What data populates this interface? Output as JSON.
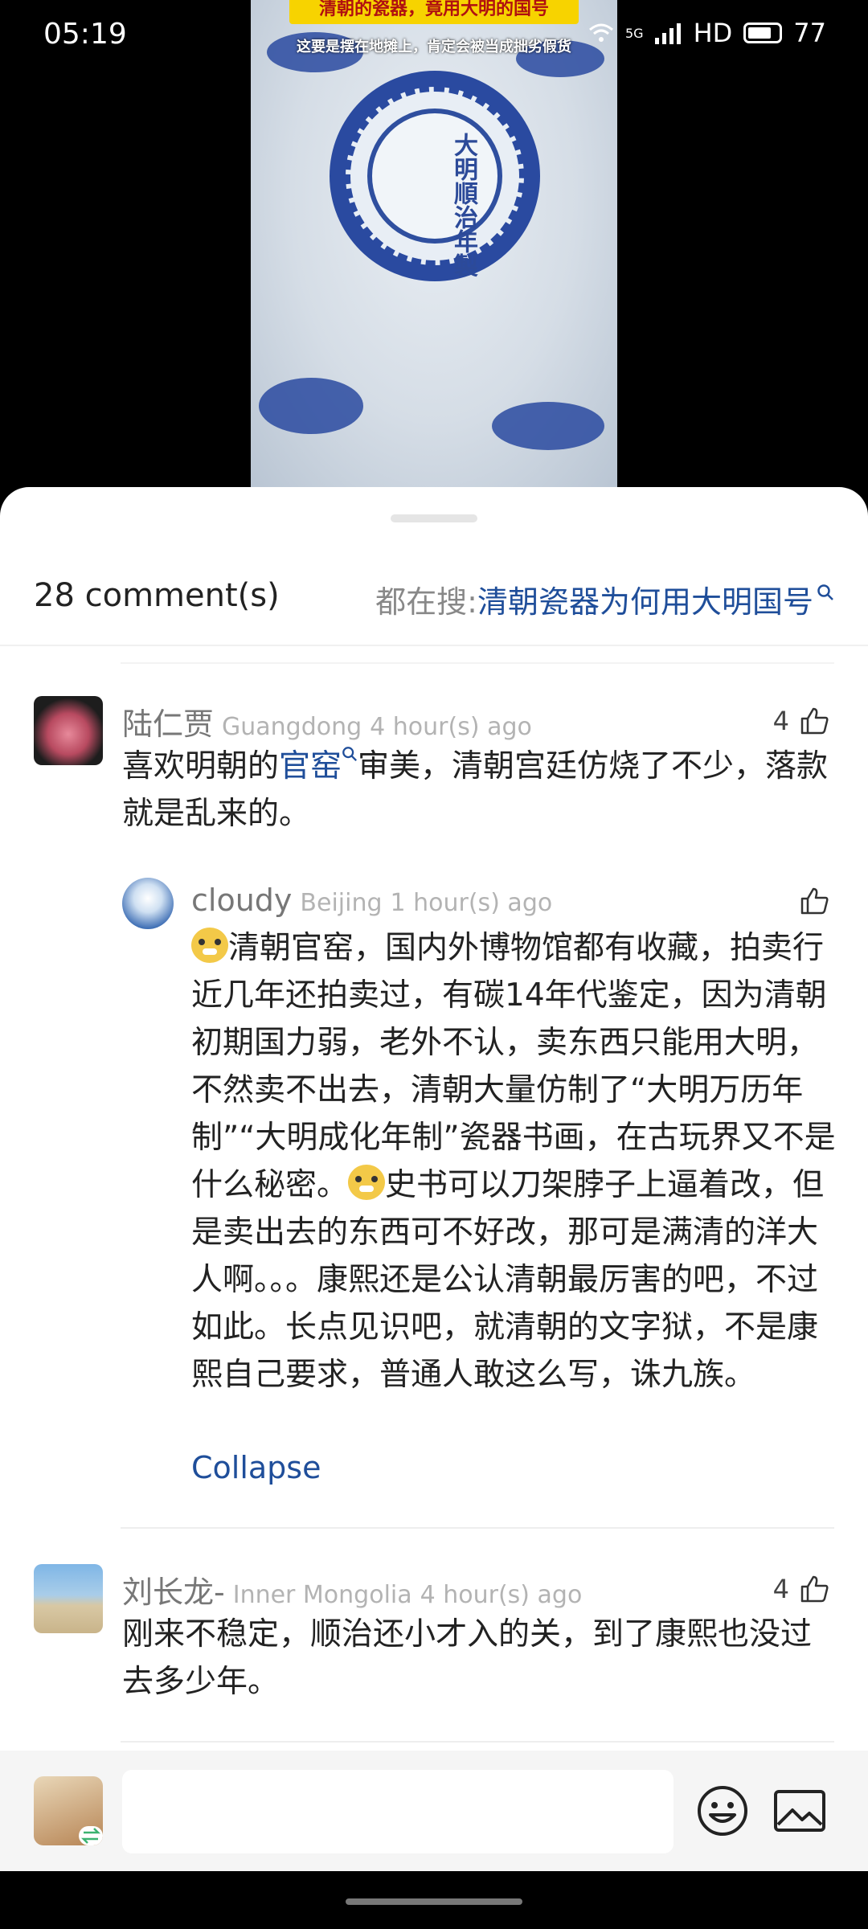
{
  "status_bar": {
    "time": "05:19",
    "network": "5G",
    "hd": "HD",
    "battery": "77"
  },
  "video": {
    "title": "清朝的瓷器，竟用大明的国号",
    "subtitle": "这要是摆在地摊上，肯定会被当成拙劣假货",
    "bowl_mark": "大明順治年製"
  },
  "comments_header": {
    "count": "28 comment(s)",
    "hot_search_label": "都在搜: ",
    "hot_search_query": "清朝瓷器为何用大明国号"
  },
  "comments": [
    {
      "name": "陆仁贾",
      "location": "Guangdong",
      "time": "4 hour(s) ago",
      "likes": "4",
      "text_before": "喜欢明朝的",
      "link": "官窑",
      "text_after": "审美，清朝宫廷仿烧了不少，落款就是乱来的。"
    },
    {
      "name": "cloudy",
      "location": "Beijing",
      "time": "1 hour(s) ago",
      "likes": "",
      "text_part1": "清朝官窑，国内外博物馆都有收藏，拍卖行近几年还拍卖过，有碳14年代鉴定，因为清朝初期国力弱，老外不认，卖东西只能用大明，不然卖不出去，清朝大量仿制了“大明万历年制”“大明成化年制”瓷器书画，在古玩界又不是什么秘密。",
      "text_part2": "史书可以刀架脖子上逼着改，但是卖出去的东西可不好改，那可是满清的洋大人啊。。。康熙还是公认清朝最厉害的吧，不过如此。长点见识吧，就清朝的文字狱，不是康熙自己要求，普通人敢这么写，诛九族。",
      "collapse_label": "Collapse"
    },
    {
      "name": "刘长龙-",
      "location": "Inner Mongolia",
      "time": "4 hour(s) ago",
      "likes": "4",
      "text": "刚来不稳定，顺治还小才入的关，到了康熙也没过去多少年。"
    }
  ],
  "composer": {
    "placeholder": ""
  }
}
